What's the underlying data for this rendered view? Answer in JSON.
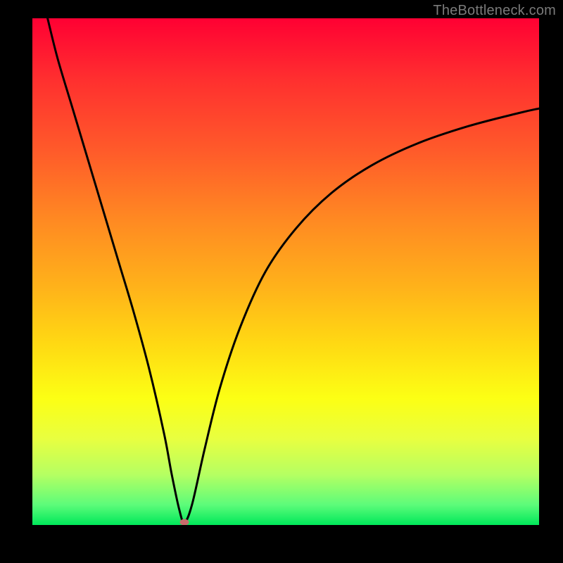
{
  "watermark": "TheBottleneck.com",
  "chart_data": {
    "type": "line",
    "title": "",
    "xlabel": "",
    "ylabel": "",
    "x_range": [
      0,
      100
    ],
    "y_range": [
      0,
      100
    ],
    "series": [
      {
        "name": "bottleneck-curve",
        "x": [
          3,
          5,
          8,
          11,
          14,
          17,
          20,
          23,
          26,
          27.5,
          29,
          30,
          31.5,
          34,
          37,
          41,
          46,
          52,
          59,
          67,
          76,
          86,
          96,
          100
        ],
        "y": [
          100,
          92,
          82,
          72,
          62,
          52,
          42,
          31,
          18,
          10,
          3,
          0.5,
          4,
          15,
          27,
          39,
          50,
          58.5,
          65.5,
          71,
          75.3,
          78.7,
          81.3,
          82.2
        ]
      }
    ],
    "marker": {
      "x": 30,
      "y": 0.5,
      "name": "optimal-point"
    },
    "background": {
      "type": "vertical-gradient",
      "stops": [
        {
          "pos": 0.0,
          "color": "#ff0033"
        },
        {
          "pos": 0.4,
          "color": "#ff8a22"
        },
        {
          "pos": 0.75,
          "color": "#fcff14"
        },
        {
          "pos": 1.0,
          "color": "#00e85a"
        }
      ],
      "meaning": "red=high bottleneck, green=low bottleneck"
    }
  }
}
